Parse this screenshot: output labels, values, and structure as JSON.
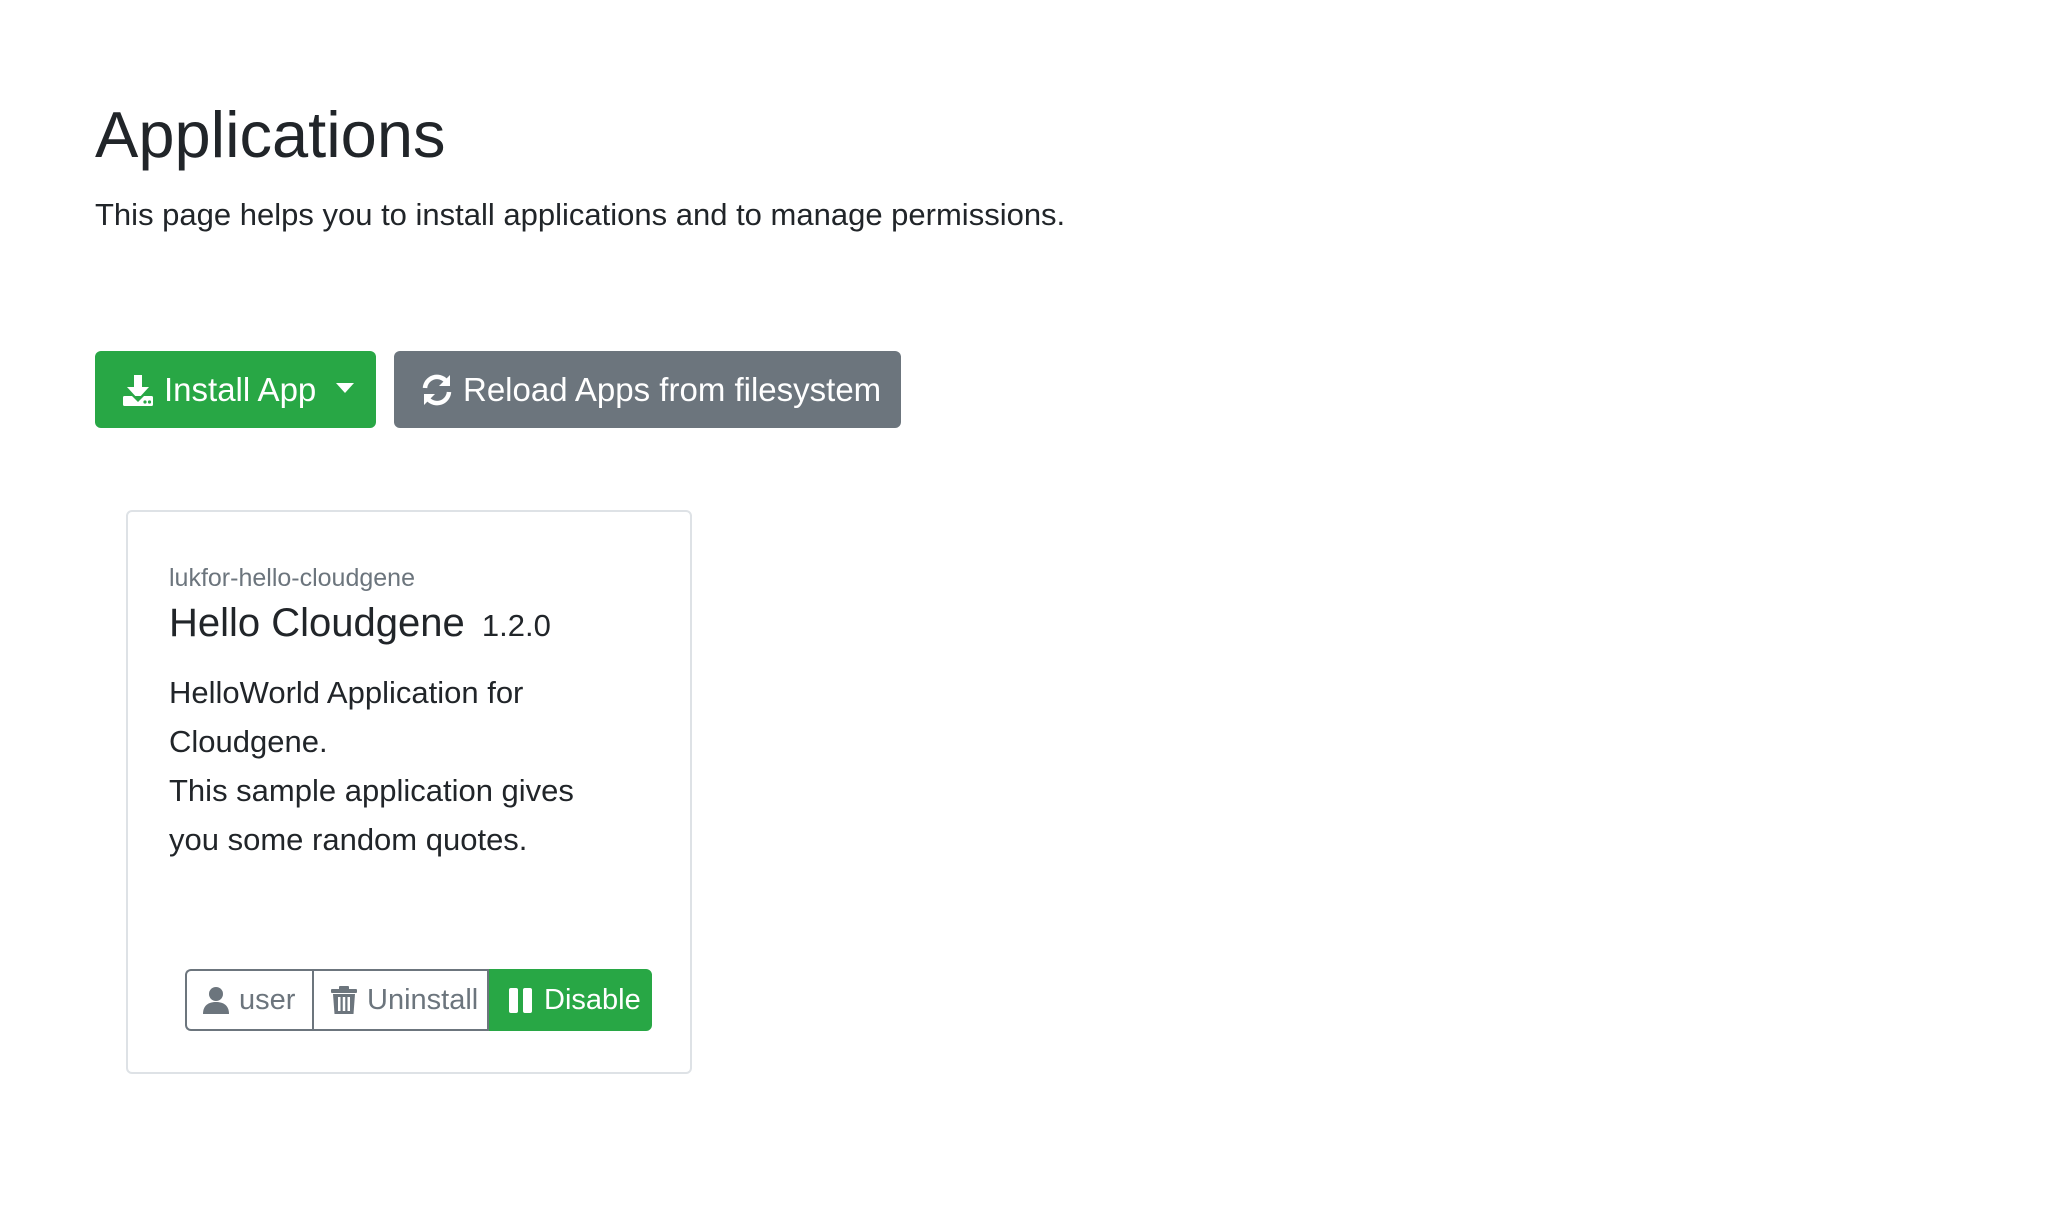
{
  "header": {
    "title": "Applications",
    "subtitle": "This page helps you to install applications and to manage permissions."
  },
  "toolbar": {
    "install_label": "Install App",
    "install_icon": "download-icon",
    "reload_label": "Reload Apps from filesystem",
    "reload_icon": "sync-icon"
  },
  "apps": [
    {
      "id": "lukfor-hello-cloudgene",
      "name": "Hello Cloudgene",
      "version": "1.2.0",
      "description_lines": [
        "HelloWorld Application for",
        "Cloudgene.",
        "This sample application gives",
        "you some random quotes."
      ],
      "actions": {
        "user_label": "user",
        "user_icon": "user-icon",
        "uninstall_label": "Uninstall",
        "uninstall_icon": "trash-icon",
        "disable_label": "Disable",
        "disable_icon": "pause-icon"
      }
    }
  ],
  "colors": {
    "success": "#28a745",
    "secondary": "#6c757d",
    "text": "#212529",
    "muted": "#6c757d",
    "border": "#dee2e6"
  }
}
